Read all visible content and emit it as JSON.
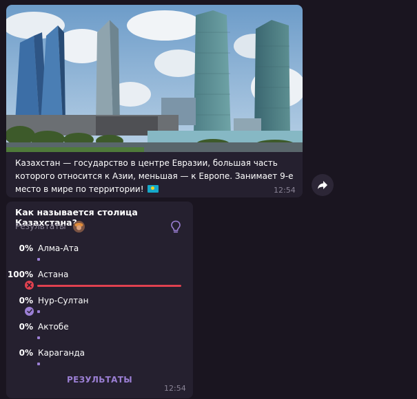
{
  "message": {
    "text": "Казахстан  — государство в центре Евразии, большая часть которого относится к Азии, меньшая — к Европе. Занимает 9-е место в мире по территории!",
    "flag_icon": "kazakhstan-flag-icon",
    "time": "12:54",
    "forward_icon": "forward-arrow-icon"
  },
  "poll": {
    "question": "Как называется столица Казахстана?",
    "subtitle": "Результаты",
    "hint_icon": "lightbulb-icon",
    "options": [
      {
        "percent": "0%",
        "label": "Алма-Ата",
        "value": 0,
        "mark": "none"
      },
      {
        "percent": "100%",
        "label": "Астана",
        "value": 100,
        "mark": "wrong"
      },
      {
        "percent": "0%",
        "label": "Нур-Султан",
        "value": 0,
        "mark": "correct"
      },
      {
        "percent": "0%",
        "label": "Актобе",
        "value": 0,
        "mark": "none"
      },
      {
        "percent": "0%",
        "label": "Караганда",
        "value": 0,
        "mark": "none"
      }
    ],
    "results_button": "РЕЗУЛЬТАТЫ",
    "time": "12:54"
  },
  "colors": {
    "accent": "#9b7fd4",
    "wrong": "#e0414f",
    "bubble": "#25202f",
    "background": "#1a1520"
  }
}
